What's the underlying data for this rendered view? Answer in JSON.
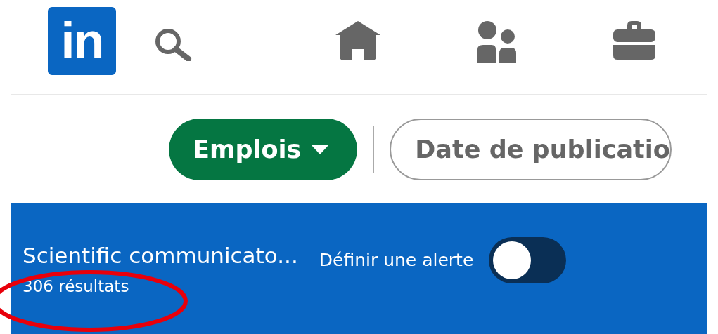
{
  "nav": {
    "logo": "in"
  },
  "filters": [
    {
      "kind": "dropdown",
      "label": "Emplois",
      "selected": true
    },
    {
      "kind": "pill",
      "label": "Date de publicatio",
      "selected": false
    }
  ],
  "results_header": {
    "title": "Scientific communicato...",
    "count": "306 résultats",
    "alert_label": "Définir une alerte",
    "alert_on": false
  },
  "annotations": [
    {
      "kind": "ellipse",
      "color": "#e8000b"
    }
  ]
}
